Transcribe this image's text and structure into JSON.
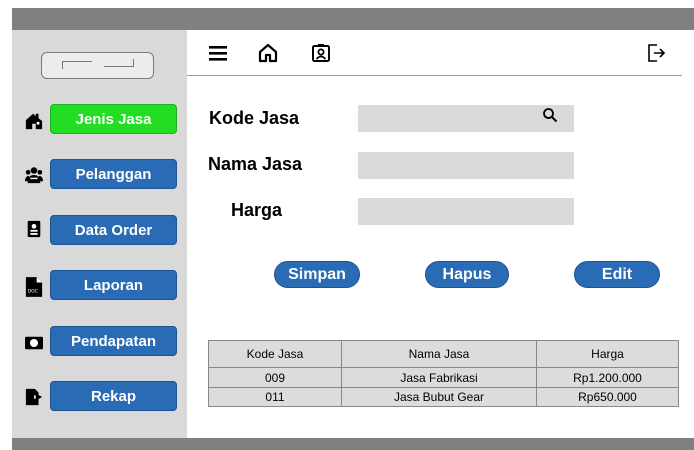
{
  "sidebar": {
    "items": [
      {
        "label": "Jenis Jasa",
        "icon": "house-icon",
        "active": true
      },
      {
        "label": "Pelanggan",
        "icon": "users-icon",
        "active": false
      },
      {
        "label": "Data Order",
        "icon": "clipboard-icon",
        "active": false
      },
      {
        "label": "Laporan",
        "icon": "doc-file-icon",
        "active": false
      },
      {
        "label": "Pendapatan",
        "icon": "money-icon",
        "active": false
      },
      {
        "label": "Rekap",
        "icon": "file-export-icon",
        "active": false
      }
    ],
    "active_color": "#22dd22",
    "button_color": "#2a6bb5"
  },
  "header": {
    "icons": [
      "menu-icon",
      "home-icon",
      "user-id-icon",
      "logout-icon"
    ]
  },
  "form": {
    "kode_label": "Kode Jasa",
    "nama_label": "Nama Jasa",
    "harga_label": "Harga",
    "kode_value": "",
    "nama_value": "",
    "harga_value": ""
  },
  "actions": {
    "simpan": "Simpan",
    "hapus": "Hapus",
    "edit": "Edit"
  },
  "table": {
    "headers": [
      "Kode Jasa",
      "Nama Jasa",
      "Harga"
    ],
    "rows": [
      [
        "009",
        "Jasa Fabrikasi",
        "Rp1.200.000"
      ],
      [
        "011",
        "Jasa Bubut Gear",
        "Rp650.000"
      ]
    ]
  }
}
